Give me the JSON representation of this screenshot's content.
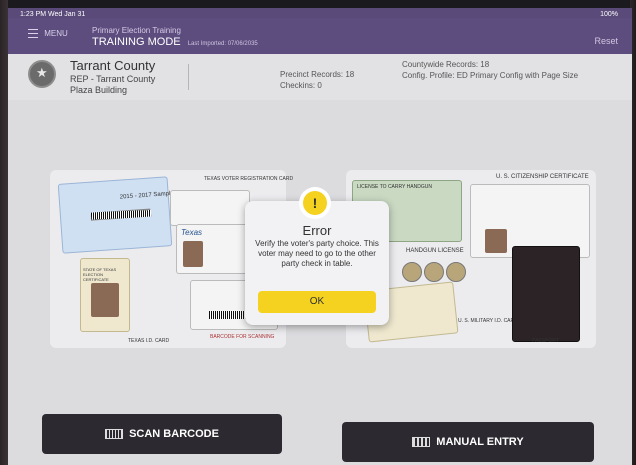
{
  "status_bar": {
    "time": "1:23 PM  Wed Jan 31",
    "battery": "100%"
  },
  "top_bar": {
    "menu_label": "MENU",
    "training_title": "Primary Election Training",
    "mode": "TRAINING MODE",
    "last_imported": "Last Imported: 07/06/2035",
    "reset_label": "Reset"
  },
  "info": {
    "county": "Tarrant County",
    "party": "REP - Tarrant County",
    "location": "Plaza Building",
    "precinct_records": "Precinct Records:  18",
    "checkins": "Checkins:  0",
    "countywide_records": "Countywide Records:  18",
    "config_profile": "Config. Profile:  ED Primary Config with Page Size"
  },
  "left_panel": {
    "voter_registration": "TEXAS VOTER REGISTRATION CARD",
    "sample_year": "2015 - 2017 Sample",
    "texas_logo": "Texas",
    "election_cert": "STATE OF TEXAS ELECTION CERTIFICATE",
    "barcode_caption": "BARCODE FOR SCANNING",
    "id_card": "TEXAS I.D. CARD"
  },
  "right_panel": {
    "license_carry": "LICENSE TO CARRY HANDGUN",
    "citizenship": "U. S. CITIZENSHIP CERTIFICATE",
    "handgun": "HANDGUN LICENSE",
    "military": "U. S. MILITARY I.D. CARD",
    "passport": "PASSPORT"
  },
  "modal": {
    "icon": "!",
    "title": "Error",
    "message": "Verify the voter's party choice. This voter may need to go to the other party check in table.",
    "ok_label": "OK"
  },
  "buttons": {
    "scan_barcode": "SCAN BARCODE",
    "manual_entry": "MANUAL ENTRY"
  },
  "colors": {
    "header": "#5d4c7e",
    "warning": "#f4d21f",
    "button": "#2c2930"
  }
}
